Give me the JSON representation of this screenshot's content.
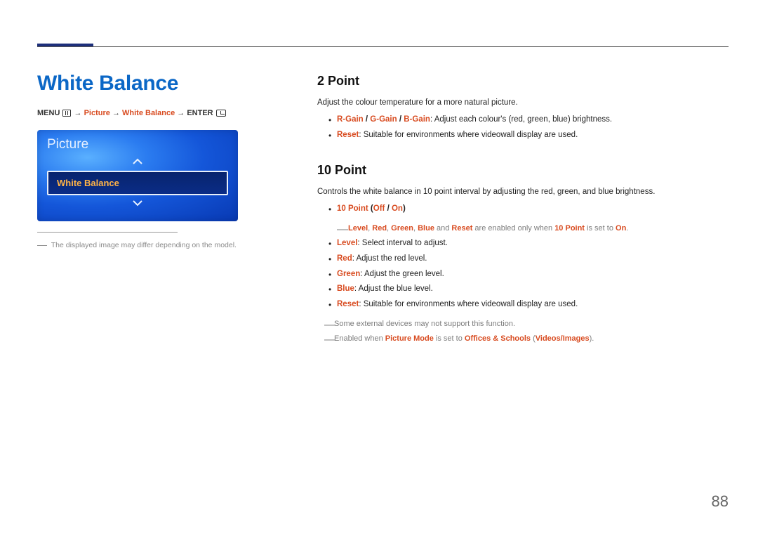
{
  "page_title": "White Balance",
  "breadcrumb": {
    "prefix": "MENU",
    "arrow": " → ",
    "item1": "Picture",
    "item2": "White Balance",
    "suffix": "ENTER"
  },
  "menu_panel": {
    "title": "Picture",
    "selected": "White Balance"
  },
  "disclaimer": "The displayed image may differ depending on the model.",
  "sections": {
    "two_point": {
      "heading": "2 Point",
      "intro": "Adjust the colour temperature for a more natural picture.",
      "gain": {
        "r": "R-Gain",
        "g": "G-Gain",
        "b": "B-Gain",
        "sep": " / ",
        "desc": ": Adjust each colour's (red, green, blue) brightness."
      },
      "reset_label": "Reset",
      "reset_desc": ": Suitable for environments where videowall display are used."
    },
    "ten_point": {
      "heading": "10 Point",
      "intro": "Controls the white balance in 10 point interval by adjusting the red, green, and blue brightness.",
      "toggle": {
        "label": "10 Point",
        "open": " (",
        "off": "Off",
        "sep": " / ",
        "on": "On",
        "close": ")"
      },
      "enable_note": {
        "level": "Level",
        "comma": ", ",
        "red": "Red",
        "green": "Green",
        "blue": "Blue",
        "and": " and ",
        "reset": "Reset",
        "mid": " are enabled only when ",
        "ten": "10 Point",
        "tail": " is set to ",
        "on": "On",
        "period": "."
      },
      "level_label": "Level",
      "level_desc": ": Select interval to adjust.",
      "red_label": "Red",
      "red_desc": ": Adjust the red level.",
      "green_label": "Green",
      "green_desc": ": Adjust the green level.",
      "blue_label": "Blue",
      "blue_desc": ": Adjust the blue level.",
      "reset_label": "Reset",
      "reset_desc": ": Suitable for environments where videowall display are used.",
      "note_external": "Some external devices may not support this function.",
      "note_mode": {
        "pre": "Enabled when ",
        "pm": "Picture Mode",
        "mid": " is set to ",
        "m1": "Offices & Schools",
        "open": " (",
        "m2": "Videos/Images",
        "close": ")."
      }
    }
  },
  "page_number": "88"
}
